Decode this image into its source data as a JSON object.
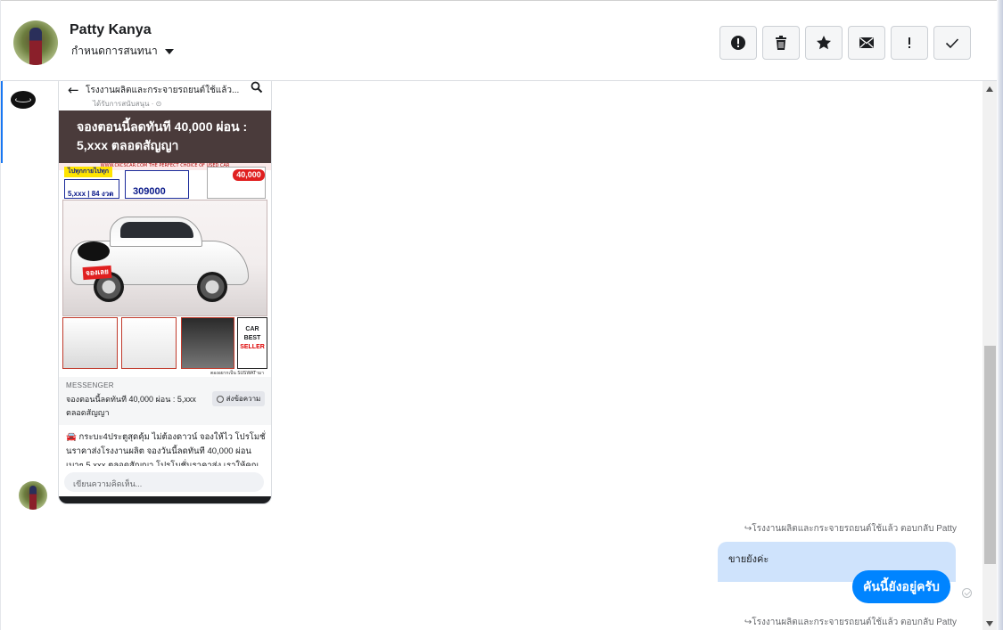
{
  "header": {
    "contact_name": "Patty Kanya",
    "assign_label": "กำหนดการสนทนา",
    "actions": [
      {
        "name": "report-spam",
        "icon": "alert-circle-icon"
      },
      {
        "name": "delete",
        "icon": "trash-icon"
      },
      {
        "name": "star",
        "icon": "star-icon"
      },
      {
        "name": "mark-unread",
        "icon": "envelope-icon"
      },
      {
        "name": "follow-up",
        "icon": "exclamation-icon"
      },
      {
        "name": "done",
        "icon": "checkmark-icon"
      }
    ]
  },
  "ad_card": {
    "page_title": "โรงงานผลิตและกระจายรถยนต์ใช้แล้ว...",
    "sponsored": "ได้รับการสนับสนุน · ",
    "banner": "จองตอนนี้ลดทันที 40,000 ผ่อน : 5,xxx ตลอดสัญญา",
    "image": {
      "top_strip": "WWW.CKCSCAR.COM THE PERFECT CHOICE OF USED CAR",
      "yellow_badge": "ไปทุกกายไปทุกทาง",
      "monthly": "5,xxx | 84 งวด",
      "price": "309000",
      "offer": "40,000",
      "stamp": "จองเลย",
      "car_best_seller_1": "CAR",
      "car_best_seller_2": "BEST",
      "car_best_seller_3": "SELLER",
      "footer": "ตองอยากเป็น SUSWATามาเป็น"
    },
    "channel_tag": "MESSENGER",
    "headline": "จองตอนนี้ลดทันที 40,000 ผ่อน : 5,xxx ตลอดสัญญา",
    "send_button": "ส่งข้อความ",
    "caption": "🚘 กระบะ4ประตูสุดคุ้ม ไม่ต้องดาวน์ จองให้ไว โปรโมชั่นราคาส่งโรงงานผลิต จองวันนี้ลดทันที 40,000 ผ่อน เบาๆ 5,xxx ตลอดสัญญา โปรโมชั่นราคาส่ง เราให้คุณ",
    "comment_placeholder": "เขียนความคิดเห็น..."
  },
  "messages": [
    {
      "type": "reply-note",
      "text": "↪โรงงานผลิตและกระจายรถยนต์ใช้แล้ว ตอบกลับ Patty"
    },
    {
      "type": "quoted",
      "text": "ขายยังค่ะ"
    },
    {
      "type": "outgoing",
      "text": "คันนี้ยังอยู่ครับ"
    },
    {
      "type": "reply-note",
      "text": "↪โรงงานผลิตและกระจายรถยนต์ใช้แล้ว ตอบกลับ Patty"
    }
  ],
  "colors": {
    "accent": "#1877f2",
    "outgoing_bubble": "#0084ff",
    "quoted_bubble": "#cfe3fc"
  }
}
